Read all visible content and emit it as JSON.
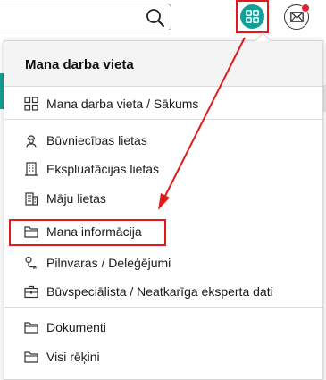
{
  "header": {
    "search": {
      "value": "",
      "icon": "search-icon"
    },
    "apps_button": {
      "icon": "grid-icon",
      "color": "#14a096",
      "highlight_color": "#e01b1b"
    },
    "mail_button": {
      "icon": "envelope-icon",
      "badge_color": "#e0223a"
    }
  },
  "menu": {
    "title": "Mana darba vieta",
    "items": [
      {
        "label": "Mana darba vieta / Sākums",
        "icon": "grid-icon"
      },
      {
        "label": "Būvniecības lietas",
        "icon": "worker-icon"
      },
      {
        "label": "Ekspluatācijas lietas",
        "icon": "building-icon"
      },
      {
        "label": "Māju lietas",
        "icon": "apartment-icon"
      },
      {
        "label": "Mana informācija",
        "icon": "folder-icon",
        "highlighted": true
      },
      {
        "label": "Pilnvaras / Deleģējumi",
        "icon": "key-icon"
      },
      {
        "label": "Būvspeciālista / Neatkarīga eksperta dati",
        "icon": "briefcase-icon"
      },
      {
        "label": "Dokumenti",
        "icon": "folder-icon"
      },
      {
        "label": "Visi rēķini",
        "icon": "folder-icon"
      }
    ]
  },
  "annotation": {
    "arrow_color": "#e01b1b"
  }
}
